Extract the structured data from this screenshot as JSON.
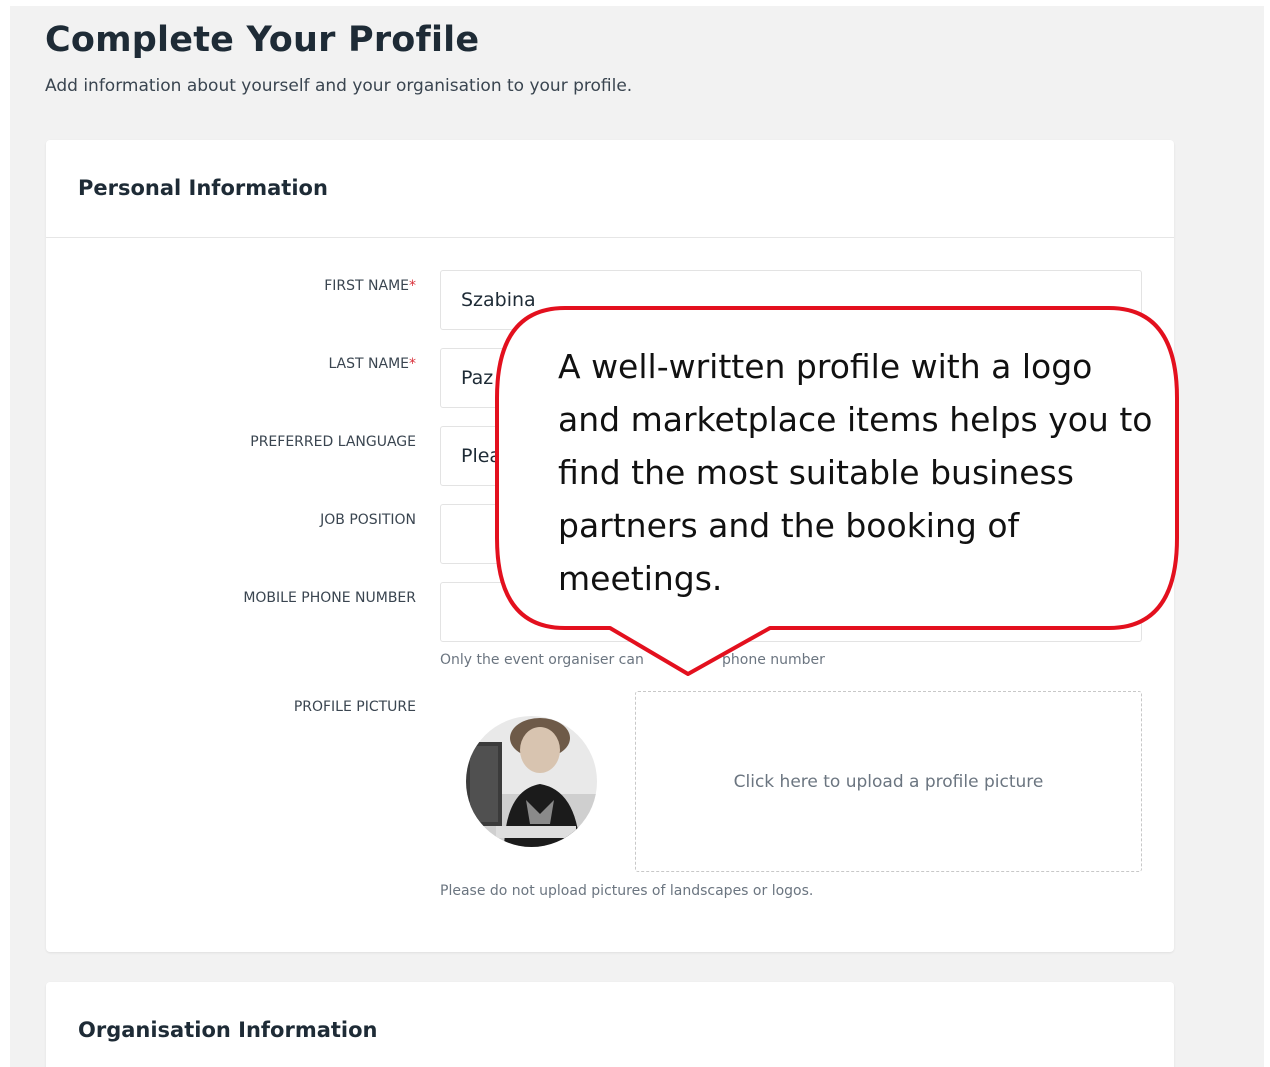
{
  "header": {
    "title": "Complete Your Profile",
    "subtitle": "Add information about yourself and your organisation to your profile."
  },
  "personal": {
    "title": "Personal Information",
    "fields": {
      "first_name": {
        "label": "FIRST NAME",
        "required_mark": "*",
        "value": "Szabina"
      },
      "last_name": {
        "label": "LAST NAME",
        "required_mark": "*",
        "value": "Paz"
      },
      "preferred_language": {
        "label": "PREFERRED LANGUAGE",
        "value": "Plea"
      },
      "job_position": {
        "label": "JOB POSITION",
        "value": ""
      },
      "mobile_phone": {
        "label": "MOBILE PHONE NUMBER",
        "value": "",
        "help_left": "Only the event organiser can",
        "help_right": "phone number"
      }
    },
    "profile_picture": {
      "label": "PROFILE PICTURE",
      "upload_text": "Click here to upload a profile picture",
      "help": "Please do not upload pictures of landscapes or logos."
    }
  },
  "organisation": {
    "title": "Organisation Information"
  },
  "callout": {
    "text": "A well-written profile with a logo and marketplace items helps you to find the most suitable business partners and the booking of meetings.",
    "border_color": "#e3101e"
  },
  "colors": {
    "background": "#f2f2f2",
    "required": "#d9303a",
    "text": "#1e2b36"
  }
}
